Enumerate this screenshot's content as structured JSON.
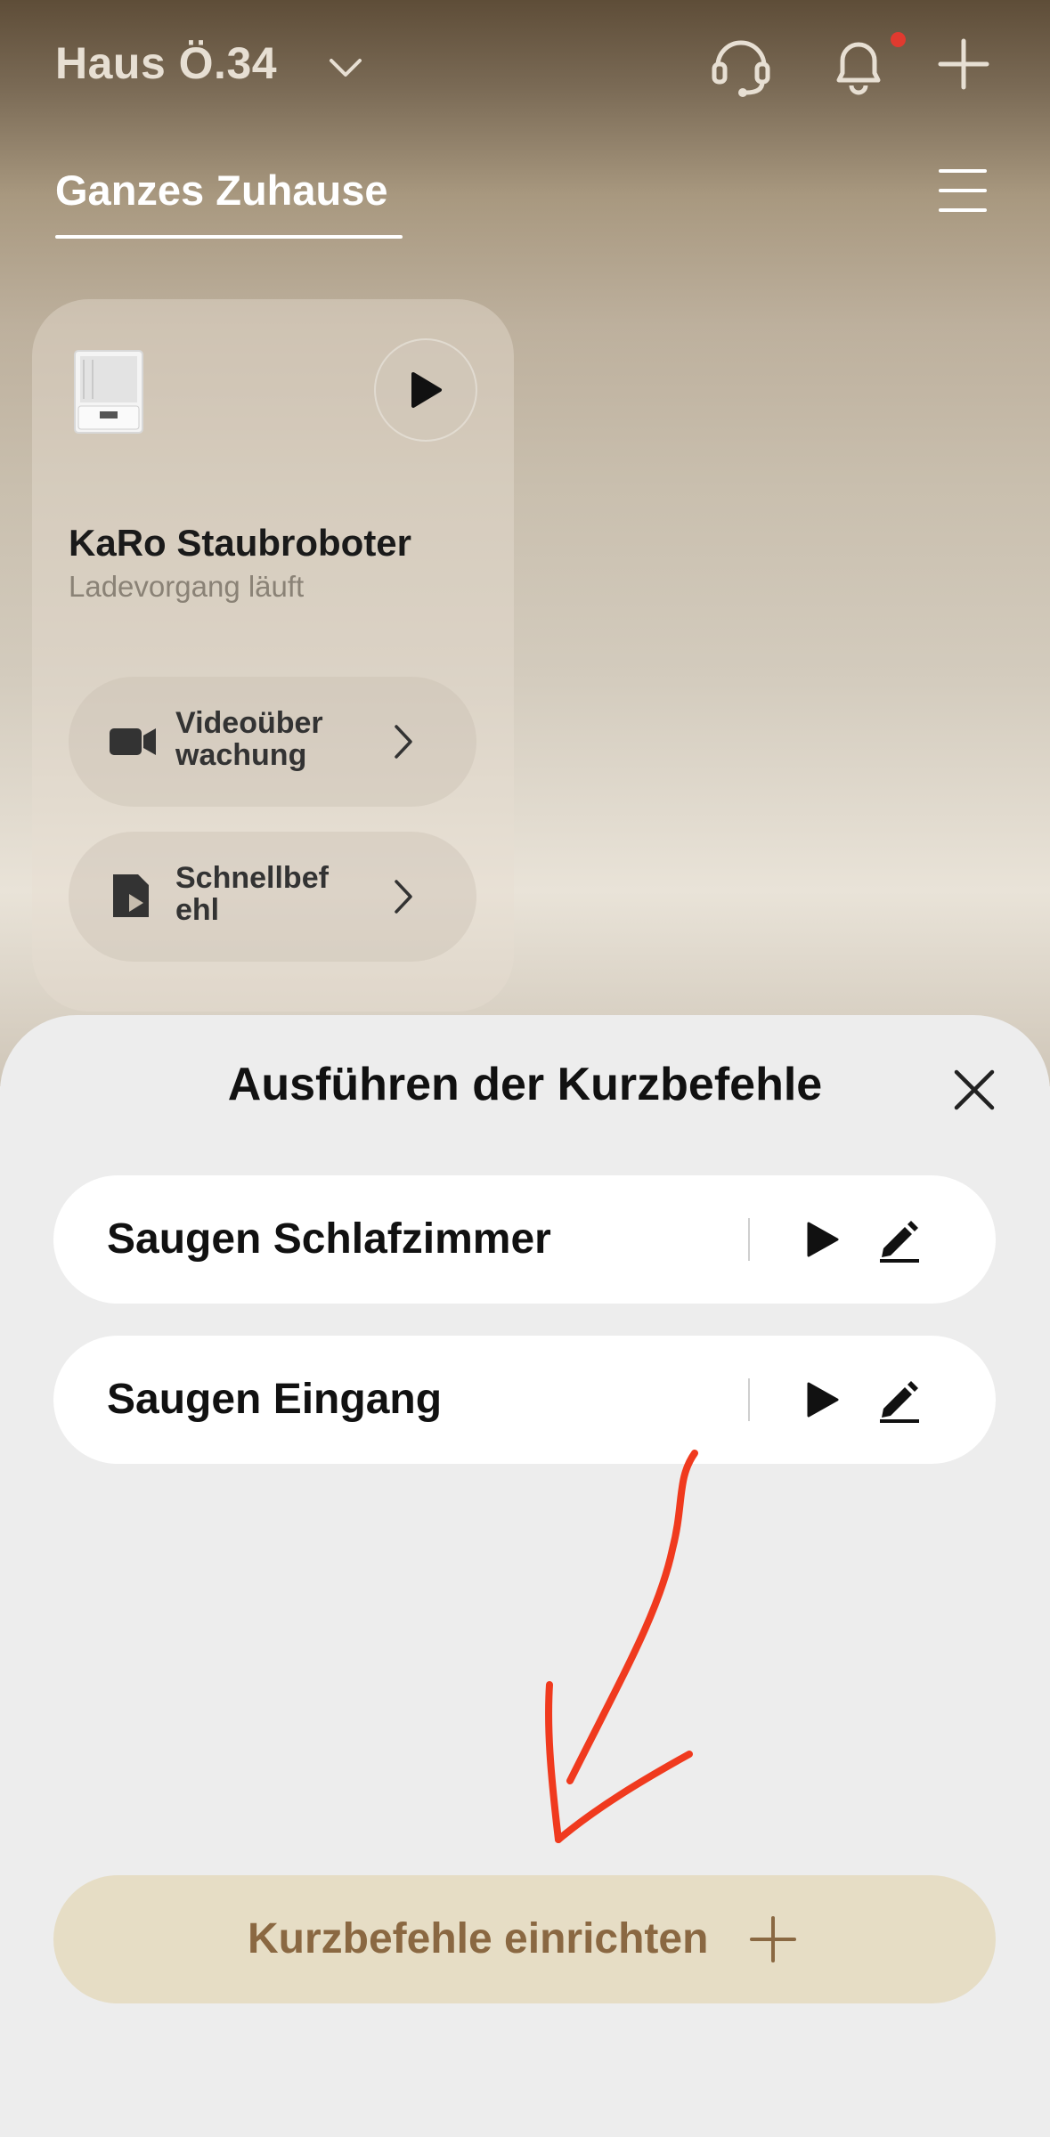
{
  "header": {
    "home_name": "Haus Ö.34"
  },
  "tabs": {
    "active": "Ganzes Zuhause"
  },
  "device": {
    "name": "KaRo Staubroboter",
    "status": "Ladevorgang läuft",
    "actions": [
      {
        "label": "Videoüber\nwachung",
        "icon": "camera-icon"
      },
      {
        "label": "Schnellbef\nehl",
        "icon": "shortcut-doc-icon"
      }
    ]
  },
  "sheet": {
    "title": "Ausführen der Kurzbefehle",
    "shortcuts": [
      {
        "label": "Saugen Schlafzimmer"
      },
      {
        "label": "Saugen Eingang"
      }
    ],
    "cta_label": "Kurzbefehle einrichten"
  },
  "colors": {
    "annotation_arrow": "#f03a1e",
    "cta_bg": "#e6ddc5",
    "cta_text": "#8a6842",
    "notification_dot": "#e03a2f"
  }
}
